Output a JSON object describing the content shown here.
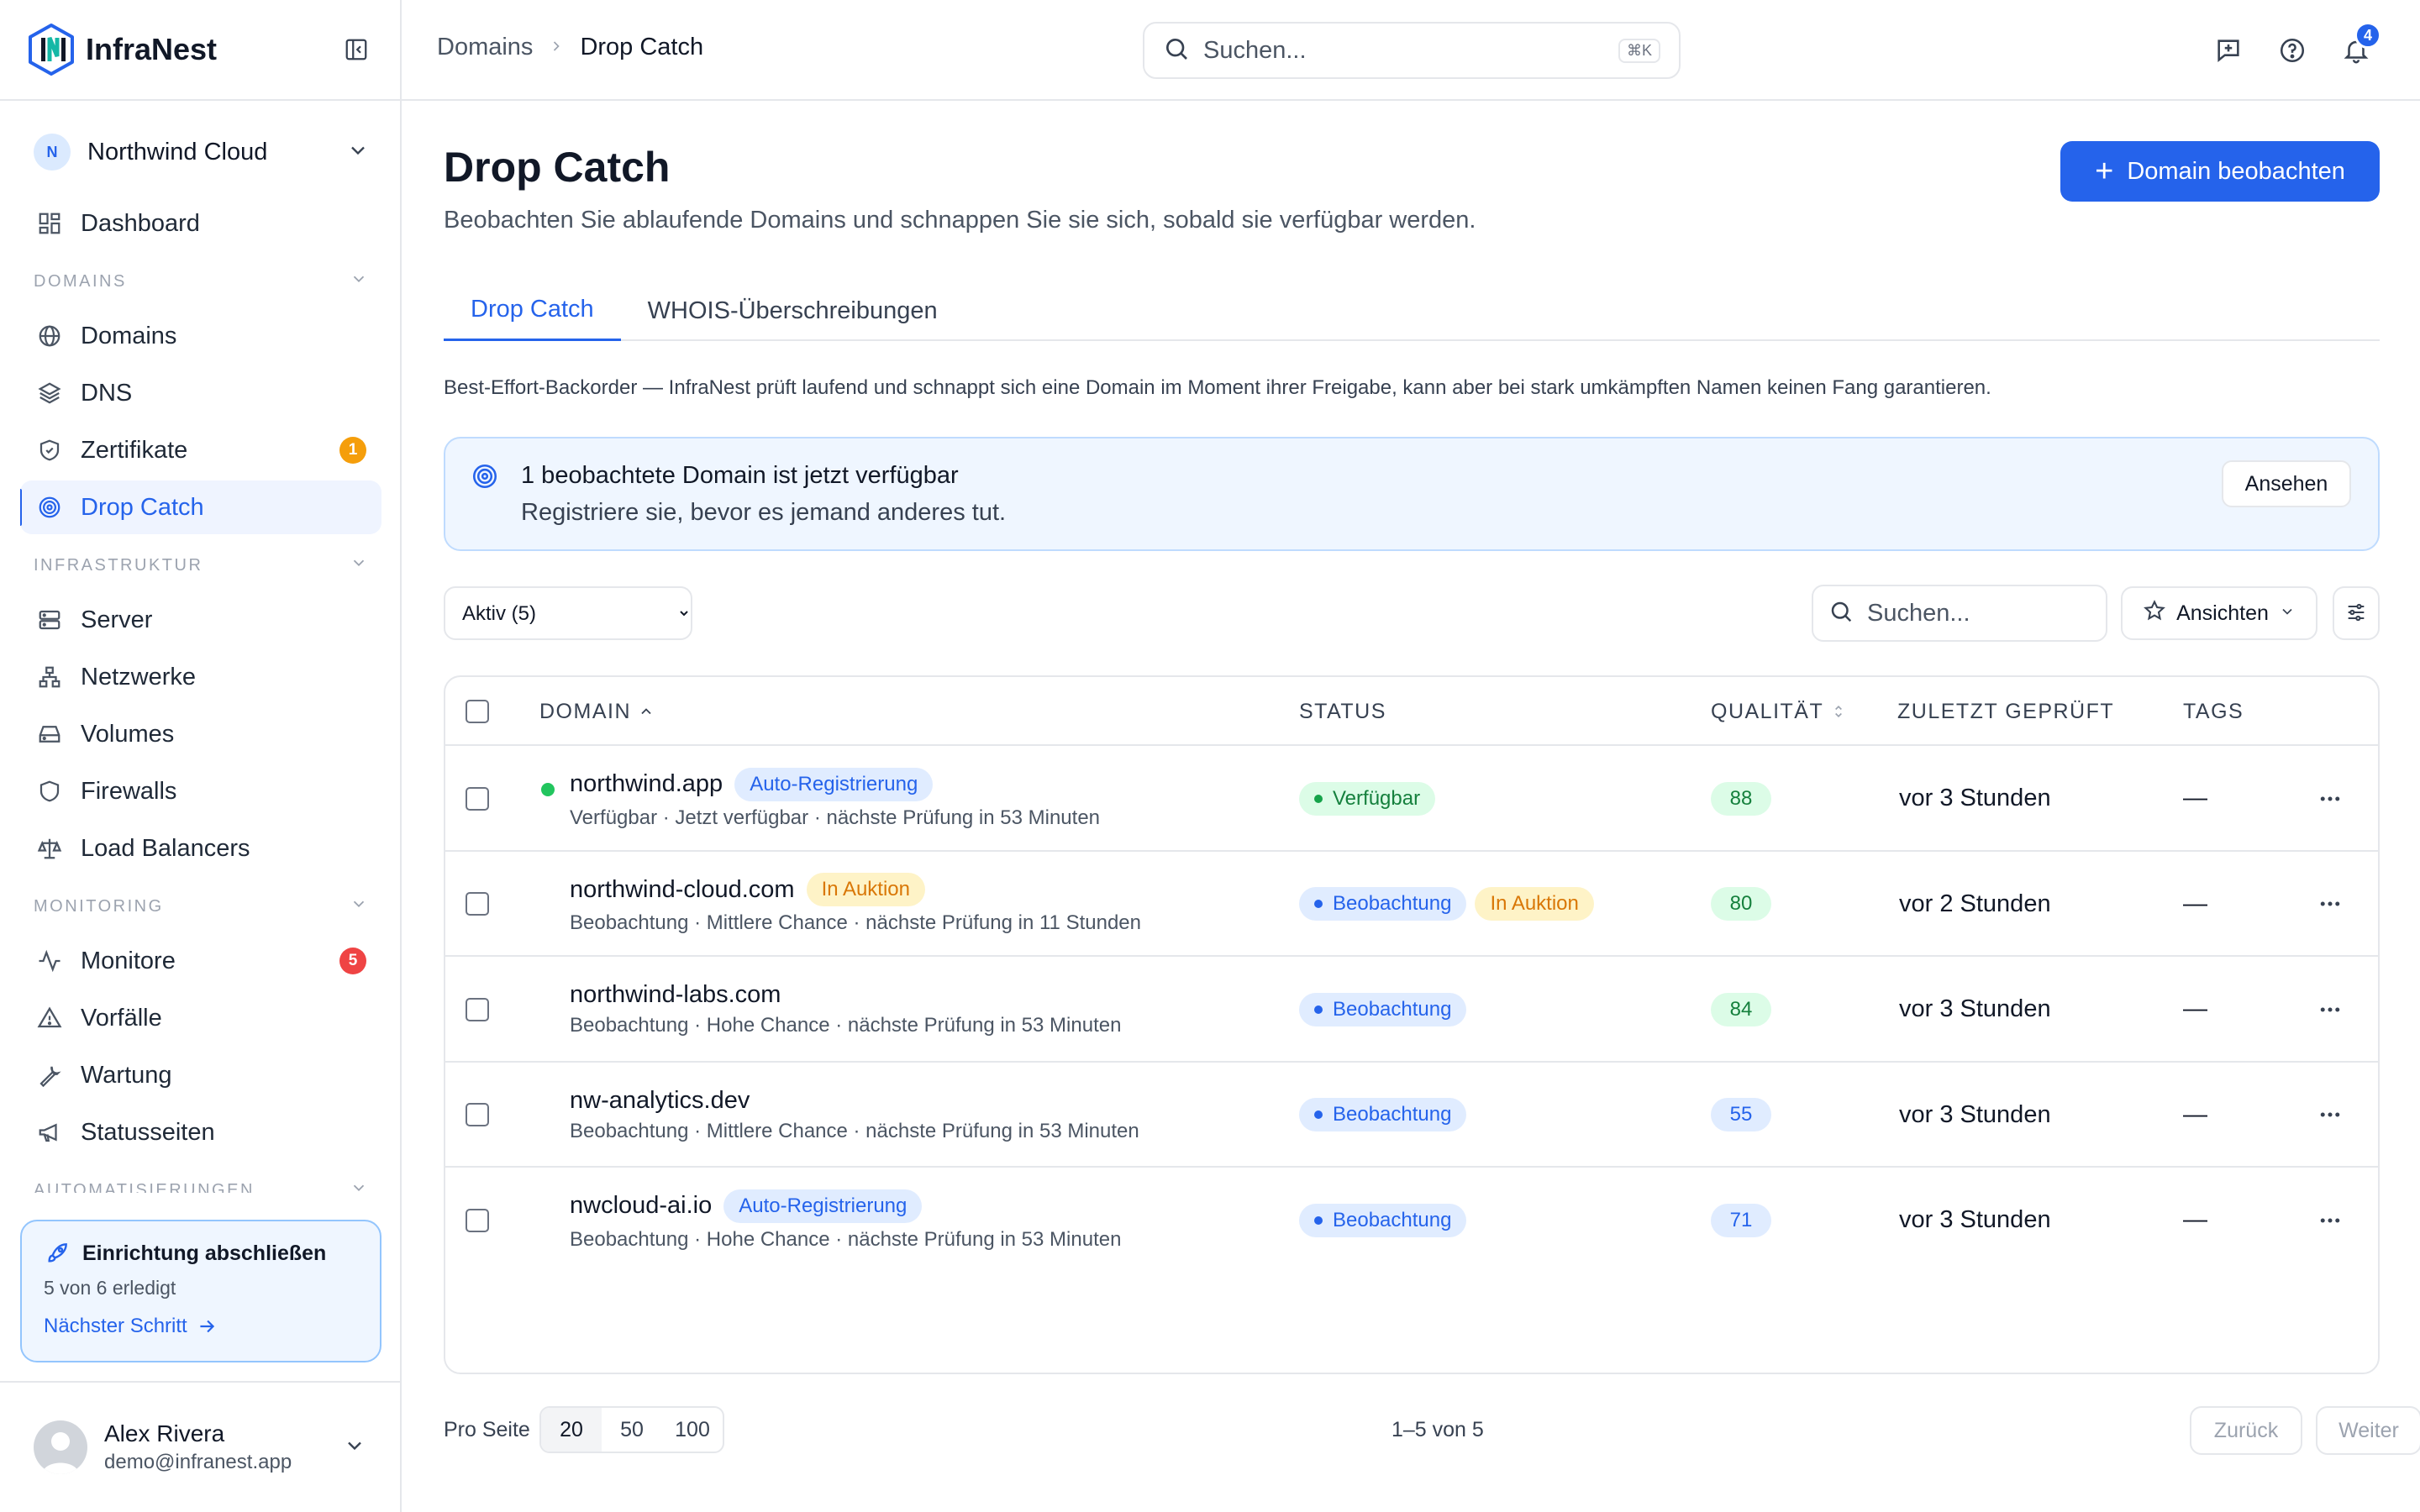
{
  "app": {
    "name": "InfraNest",
    "org_initial": "N",
    "org_name": "Northwind Cloud"
  },
  "sidebar": {
    "dashboard": "Dashboard",
    "sections": {
      "domains": "DOMAINS",
      "infra": "INFRASTRUKTUR",
      "monitoring": "MONITORING",
      "automation": "AUTOMATISIERUNGEN"
    },
    "items": {
      "domains": "Domains",
      "dns": "DNS",
      "certs": "Zertifikate",
      "certs_badge": "1",
      "dropcatch": "Drop Catch",
      "server": "Server",
      "networks": "Netzwerke",
      "volumes": "Volumes",
      "firewalls": "Firewalls",
      "lb": "Load Balancers",
      "monitors": "Monitore",
      "monitors_badge": "5",
      "incidents": "Vorfälle",
      "maintenance": "Wartung",
      "status": "Statusseiten"
    },
    "setup": {
      "title": "Einrichtung abschließen",
      "progress": "5 von 6 erledigt",
      "next": "Nächster Schritt"
    },
    "user": {
      "name": "Alex Rivera",
      "email": "demo@infranest.app"
    }
  },
  "header": {
    "breadcrumb": [
      "Domains",
      "Drop Catch"
    ],
    "search_placeholder": "Suchen...",
    "shortcut": "⌘K",
    "notifications_count": "4"
  },
  "page": {
    "title": "Drop Catch",
    "subtitle": "Beobachten Sie ablaufende Domains und schnappen Sie sie sich, sobald sie verfügbar werden.",
    "primary_action": "Domain beobachten",
    "tabs": [
      "Drop Catch",
      "WHOIS-Überschreibungen"
    ],
    "info": "Best-Effort-Backorder — InfraNest prüft laufend und schnappt sich eine Domain im Moment ihrer Freigabe, kann aber bei stark umkämpften Namen keinen Fang garantieren.",
    "alert": {
      "title": "1 beobachtete Domain ist jetzt verfügbar",
      "subtitle": "Registriere sie, bevor es jemand anderes tut.",
      "action": "Ansehen"
    },
    "filter_selected": "Aktiv (5)",
    "table_search_placeholder": "Suchen...",
    "views_label": "Ansichten"
  },
  "table": {
    "columns": {
      "domain": "DOMAIN",
      "status": "STATUS",
      "quality": "QUALITÄT",
      "checked": "ZULETZT GEPRÜFT",
      "tags": "TAGS"
    },
    "rows": [
      {
        "domain": "northwind.app",
        "tag": "Auto-Registrierung",
        "sub": "Verfügbar · Jetzt verfügbar · nächste Prüfung in 53 Minuten",
        "status": "Verfügbar",
        "score": "88",
        "checked": "vor 3 Stunden",
        "tags": "—"
      },
      {
        "domain": "northwind-cloud.com",
        "tag": "In Auktion",
        "sub": "Beobachtung · Mittlere Chance · nächste Prüfung in 11 Stunden",
        "status": "Beobachtung",
        "status2": "In Auktion",
        "score": "80",
        "checked": "vor 2 Stunden",
        "tags": "—"
      },
      {
        "domain": "northwind-labs.com",
        "sub": "Beobachtung · Hohe Chance · nächste Prüfung in 53 Minuten",
        "status": "Beobachtung",
        "score": "84",
        "checked": "vor 3 Stunden",
        "tags": "—"
      },
      {
        "domain": "nw-analytics.dev",
        "sub": "Beobachtung · Mittlere Chance · nächste Prüfung in 53 Minuten",
        "status": "Beobachtung",
        "score": "55",
        "checked": "vor 3 Stunden",
        "tags": "—"
      },
      {
        "domain": "nwcloud-ai.io",
        "tag": "Auto-Registrierung",
        "sub": "Beobachtung · Hohe Chance · nächste Prüfung in 53 Minuten",
        "status": "Beobachtung",
        "score": "71",
        "checked": "vor 3 Stunden",
        "tags": "—"
      }
    ]
  },
  "footer": {
    "per_page_label": "Pro Seite",
    "per_page_options": [
      "20",
      "50",
      "100"
    ],
    "range": "1–5 von 5",
    "prev": "Zurück",
    "next": "Weiter"
  },
  "colors": {
    "accent": "#2563eb",
    "available": "#16a34a",
    "auction": "#d97706",
    "danger": "#ef4444"
  }
}
